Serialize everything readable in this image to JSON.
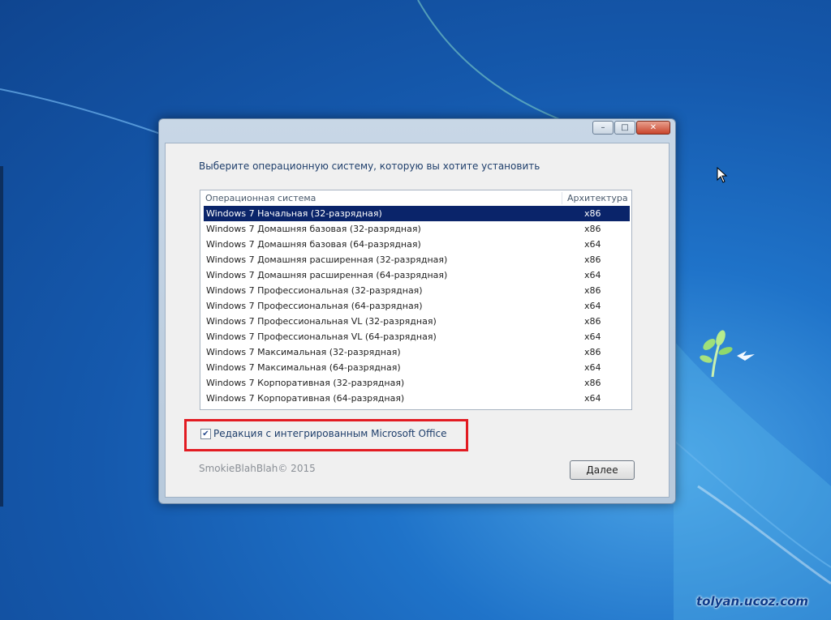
{
  "installer": {
    "prompt": "Выберите операционную систему, которую вы хотите установить",
    "columns": {
      "os": "Операционная система",
      "arch": "Архитектура"
    },
    "editions": [
      {
        "name": "Windows 7 Начальная (32-разрядная)",
        "arch": "x86",
        "selected": true
      },
      {
        "name": "Windows 7 Домашняя базовая (32-разрядная)",
        "arch": "x86"
      },
      {
        "name": "Windows 7 Домашняя базовая (64-разрядная)",
        "arch": "x64"
      },
      {
        "name": "Windows 7 Домашняя расширенная (32-разрядная)",
        "arch": "x86"
      },
      {
        "name": "Windows 7 Домашняя расширенная (64-разрядная)",
        "arch": "x64"
      },
      {
        "name": "Windows 7 Профессиональная (32-разрядная)",
        "arch": "x86"
      },
      {
        "name": "Windows 7 Профессиональная (64-разрядная)",
        "arch": "x64"
      },
      {
        "name": "Windows 7 Профессиональная VL (32-разрядная)",
        "arch": "x86"
      },
      {
        "name": "Windows 7 Профессиональная VL (64-разрядная)",
        "arch": "x64"
      },
      {
        "name": "Windows 7 Максимальная (32-разрядная)",
        "arch": "x86"
      },
      {
        "name": "Windows 7 Максимальная (64-разрядная)",
        "arch": "x64"
      },
      {
        "name": "Windows 7 Корпоративная (32-разрядная)",
        "arch": "x86"
      },
      {
        "name": "Windows 7 Корпоративная (64-разрядная)",
        "arch": "x64"
      }
    ],
    "office_option": {
      "label": "Редакция с интегрированным Microsoft Office",
      "checked": true
    },
    "copyright": "SmokieBlahBlah© 2015",
    "next_button": "Далее"
  },
  "window_controls": {
    "minimize_icon": "minimize-icon",
    "maximize_icon": "maximize-icon",
    "close_icon": "close-icon"
  },
  "watermark": "tolyan.ucoz.com",
  "colors": {
    "selection": "#0a246a",
    "highlight_box": "#e21b22",
    "desktop": "#1f73c9"
  }
}
